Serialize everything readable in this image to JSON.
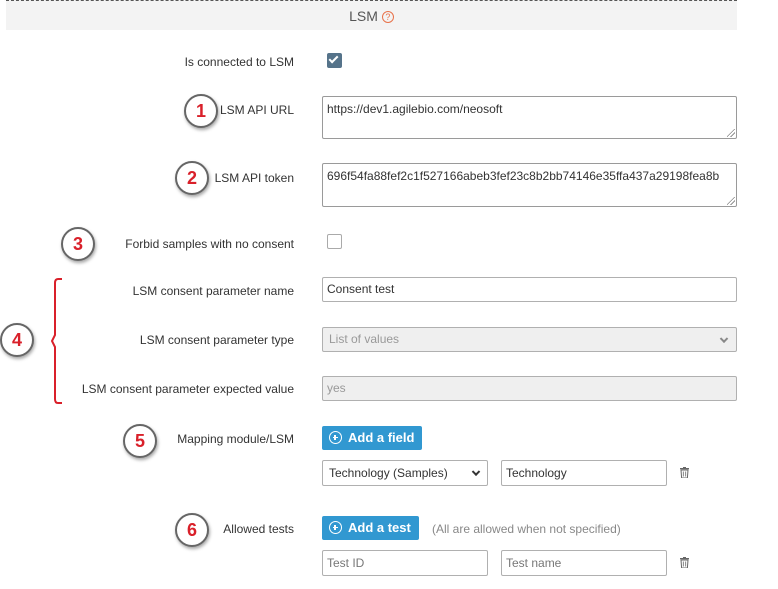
{
  "header": {
    "title": "LSM",
    "help_symbol": "?"
  },
  "markers": [
    "1",
    "2",
    "3",
    "4",
    "5",
    "6"
  ],
  "connected": {
    "label": "Is connected to LSM",
    "checked": true
  },
  "api_url": {
    "label": "LSM API URL",
    "value": "https://dev1.agilebio.com/neosoft"
  },
  "api_token": {
    "label": "LSM API token",
    "value": "696f54fa88fef2c1f527166abeb3fef23c8b2bb74146e35ffa437a29198fea8b"
  },
  "forbid": {
    "label": "Forbid samples with no consent",
    "checked": false
  },
  "consent_name": {
    "label": "LSM consent parameter name",
    "value": "Consent test"
  },
  "consent_type": {
    "label": "LSM consent parameter type",
    "value": "List of values"
  },
  "consent_expected": {
    "label": "LSM consent parameter expected value",
    "placeholder": "yes"
  },
  "mapping": {
    "label": "Mapping module/LSM",
    "add_button": "Add a field",
    "row": {
      "module_field": "Technology (Samples)",
      "lsm_field": "Technology"
    }
  },
  "tests": {
    "label": "Allowed tests",
    "add_button": "Add a test",
    "hint": "(All are allowed when not specified)",
    "row": {
      "id_placeholder": "Test ID",
      "name_placeholder": "Test name"
    }
  },
  "colors": {
    "accent": "#3198d1",
    "marker": "#d9202a",
    "checkbox": "#55738a",
    "help": "#e8724a"
  }
}
